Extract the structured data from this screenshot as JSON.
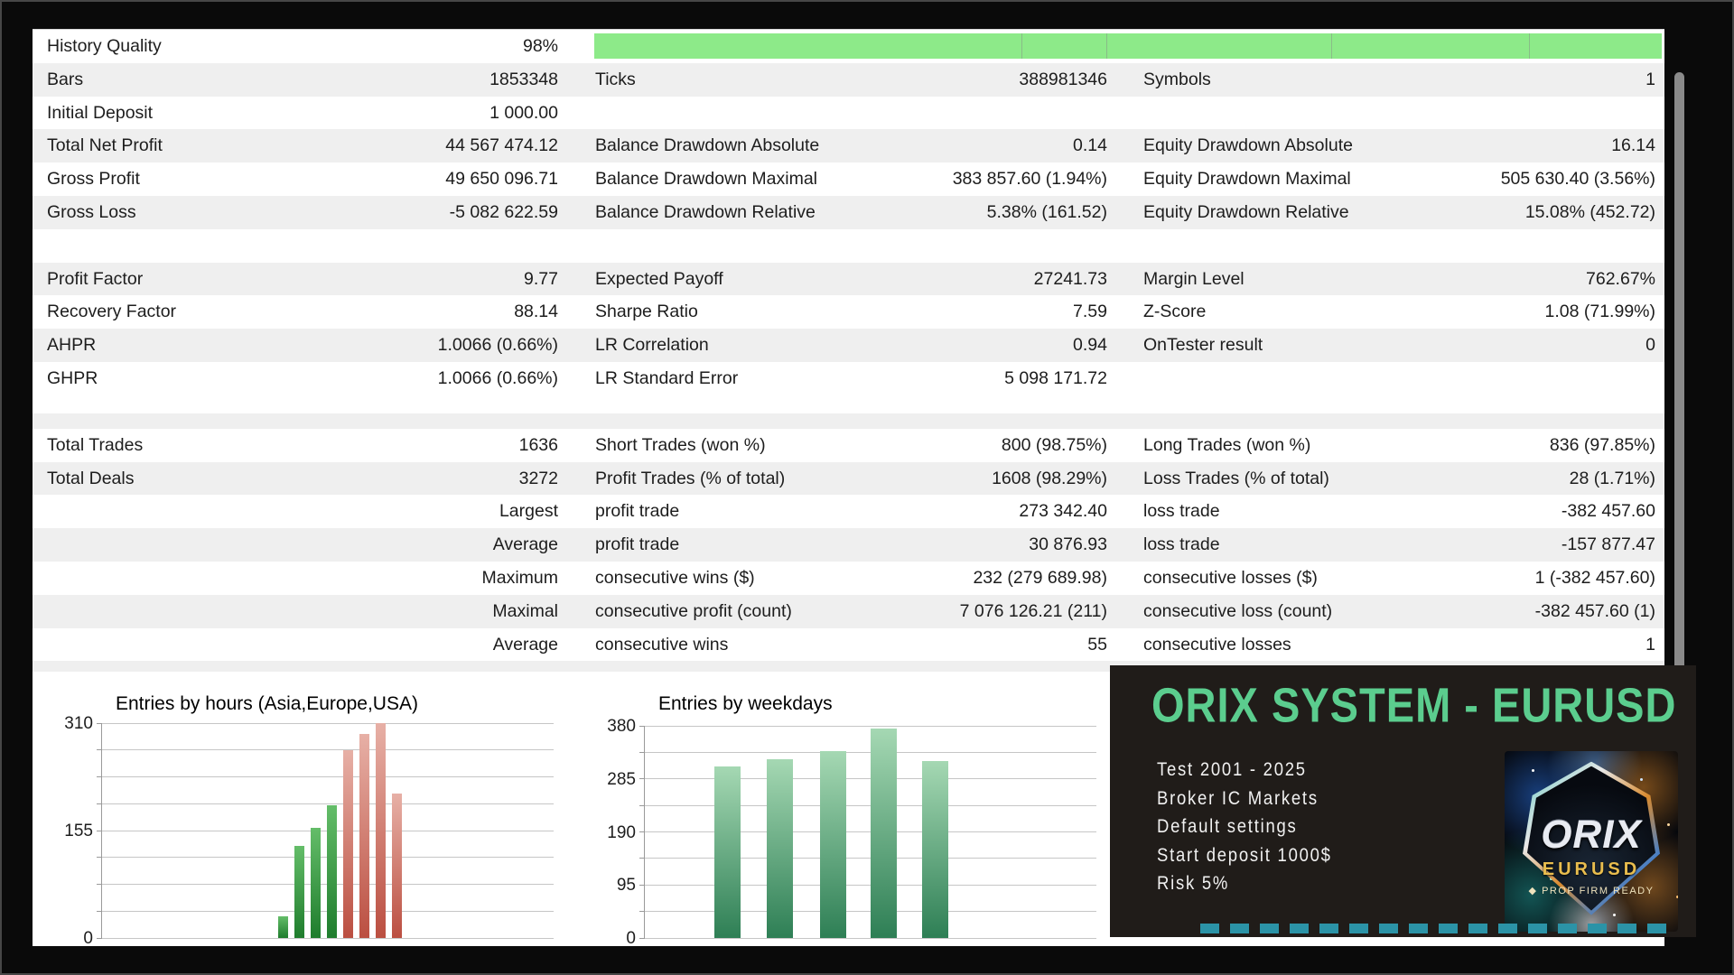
{
  "quality_bar": {
    "color": "#8dea89",
    "dividers_frac": [
      0.4,
      0.48,
      0.69,
      0.876
    ]
  },
  "table": {
    "rows": [
      {
        "type": "quality",
        "shade": "w",
        "c1l": "History Quality",
        "c1v": "98%"
      },
      {
        "shade": "g",
        "c1l": "Bars",
        "c1v": "1853348",
        "c2l": "Ticks",
        "c2v": "388981346",
        "c3l": "Symbols",
        "c3v": "1"
      },
      {
        "shade": "w",
        "c1l": "Initial Deposit",
        "c1v": "1 000.00"
      },
      {
        "shade": "g",
        "c1l": "Total Net Profit",
        "c1v": "44 567 474.12",
        "c2l": "Balance Drawdown Absolute",
        "c2v": "0.14",
        "c3l": "Equity Drawdown Absolute",
        "c3v": "16.14"
      },
      {
        "shade": "w",
        "c1l": "Gross Profit",
        "c1v": "49 650 096.71",
        "c2l": "Balance Drawdown Maximal",
        "c2v": "383 857.60 (1.94%)",
        "c3l": "Equity Drawdown Maximal",
        "c3v": "505 630.40 (3.56%)"
      },
      {
        "shade": "g",
        "c1l": "Gross Loss",
        "c1v": "-5 082 622.59",
        "c2l": "Balance Drawdown Relative",
        "c2v": "5.38% (161.52)",
        "c3l": "Equity Drawdown Relative",
        "c3v": "15.08% (452.72)"
      },
      {
        "type": "blank",
        "shade": "w"
      },
      {
        "shade": "g",
        "c1l": "Profit Factor",
        "c1v": "9.77",
        "c2l": "Expected Payoff",
        "c2v": "27241.73",
        "c3l": "Margin Level",
        "c3v": "762.67%"
      },
      {
        "shade": "w",
        "c1l": "Recovery Factor",
        "c1v": "88.14",
        "c2l": "Sharpe Ratio",
        "c2v": "7.59",
        "c3l": "Z-Score",
        "c3v": "1.08 (71.99%)"
      },
      {
        "shade": "g",
        "c1l": "AHPR",
        "c1v": "1.0066 (0.66%)",
        "c2l": "LR Correlation",
        "c2v": "0.94",
        "c3l": "OnTester result",
        "c3v": "0"
      },
      {
        "shade": "w",
        "c1l": "GHPR",
        "c1v": "1.0066 (0.66%)",
        "c2l": "LR Standard Error",
        "c2v": "5 098 171.72"
      },
      {
        "type": "blank2"
      },
      {
        "shade": "w",
        "c1l": "Total Trades",
        "c1v": "1636",
        "c2l": "Short Trades (won %)",
        "c2v": "800 (98.75%)",
        "c3l": "Long Trades (won %)",
        "c3v": "836 (97.85%)"
      },
      {
        "shade": "g",
        "c1l": "Total Deals",
        "c1v": "3272",
        "c2l": "Profit Trades (% of total)",
        "c2v": "1608 (98.29%)",
        "c3l": "Loss Trades (% of total)",
        "c3v": "28 (1.71%)"
      },
      {
        "shade": "w",
        "c1v": "Largest",
        "c2l": "profit trade",
        "c2v": "273 342.40",
        "c3l": "loss trade",
        "c3v": "-382 457.60"
      },
      {
        "shade": "g",
        "c1v": "Average",
        "c2l": "profit trade",
        "c2v": "30 876.93",
        "c3l": "loss trade",
        "c3v": "-157 877.47"
      },
      {
        "shade": "w",
        "c1v": "Maximum",
        "c2l": "consecutive wins ($)",
        "c2v": "232 (279 689.98)",
        "c3l": "consecutive losses ($)",
        "c3v": "1 (-382 457.60)"
      },
      {
        "shade": "g",
        "c1v": "Maximal",
        "c2l": "consecutive profit (count)",
        "c2v": "7 076 126.21 (211)",
        "c3l": "consecutive loss (count)",
        "c3v": "-382 457.60 (1)"
      },
      {
        "shade": "w",
        "c1v": "Average",
        "c2l": "consecutive wins",
        "c2v": "55",
        "c3l": "consecutive losses",
        "c3v": "1"
      }
    ]
  },
  "chart_colors": {
    "green": [
      "#64bd69",
      "#1f7d2d"
    ],
    "red": [
      "#e7b0a6",
      "#bb4f41"
    ],
    "teal": [
      "#a5d8b3",
      "#2e7f55"
    ]
  },
  "chart_data": [
    {
      "type": "bar",
      "title": "Entries by hours (Asia,Europe,USA)",
      "values": [
        31,
        133,
        159,
        191,
        271,
        295,
        310,
        209
      ],
      "bar_colors": [
        "green",
        "green",
        "green",
        "green",
        "red",
        "red",
        "red",
        "red"
      ],
      "ylim": [
        0,
        310
      ],
      "yticks": [
        {
          "value": 310,
          "label": "310"
        },
        {
          "value": 155,
          "label": "155"
        },
        {
          "value": 0,
          "label": "0"
        }
      ],
      "grid_divisions": 8,
      "grid": true,
      "x_axis_labels_visible": false,
      "x_frac": [
        0.389,
        0.425,
        0.461,
        0.497,
        0.533,
        0.569,
        0.605,
        0.641
      ],
      "bar_w_frac": 0.023
    },
    {
      "type": "bar",
      "title": "Entries by weekdays",
      "values": [
        307,
        320,
        335,
        375,
        317
      ],
      "bar_colors": [
        "teal",
        "teal",
        "teal",
        "teal",
        "teal"
      ],
      "ylim": [
        0,
        380
      ],
      "yticks": [
        {
          "value": 380,
          "label": "380"
        },
        {
          "value": 285,
          "label": "285"
        },
        {
          "value": 190,
          "label": "190"
        },
        {
          "value": 95,
          "label": "95"
        },
        {
          "value": 0,
          "label": "0"
        }
      ],
      "grid_divisions": 8,
      "grid": true,
      "x_axis_labels_visible": false,
      "x_frac": [
        0.154,
        0.269,
        0.387,
        0.499,
        0.613
      ],
      "bar_w_frac": 0.058
    }
  ],
  "panel": {
    "title": "ORIX SYSTEM - EURUSD",
    "accent_color": "#5bcd8e",
    "lines": [
      "Test 2001 - 2025",
      "Broker IC Markets",
      "Default settings",
      "Start deposit 1000$",
      "Risk 5%"
    ],
    "logo": {
      "name": "ORIX",
      "pair": "EURUSD",
      "tag": "◆ PROP FIRM READY"
    }
  }
}
